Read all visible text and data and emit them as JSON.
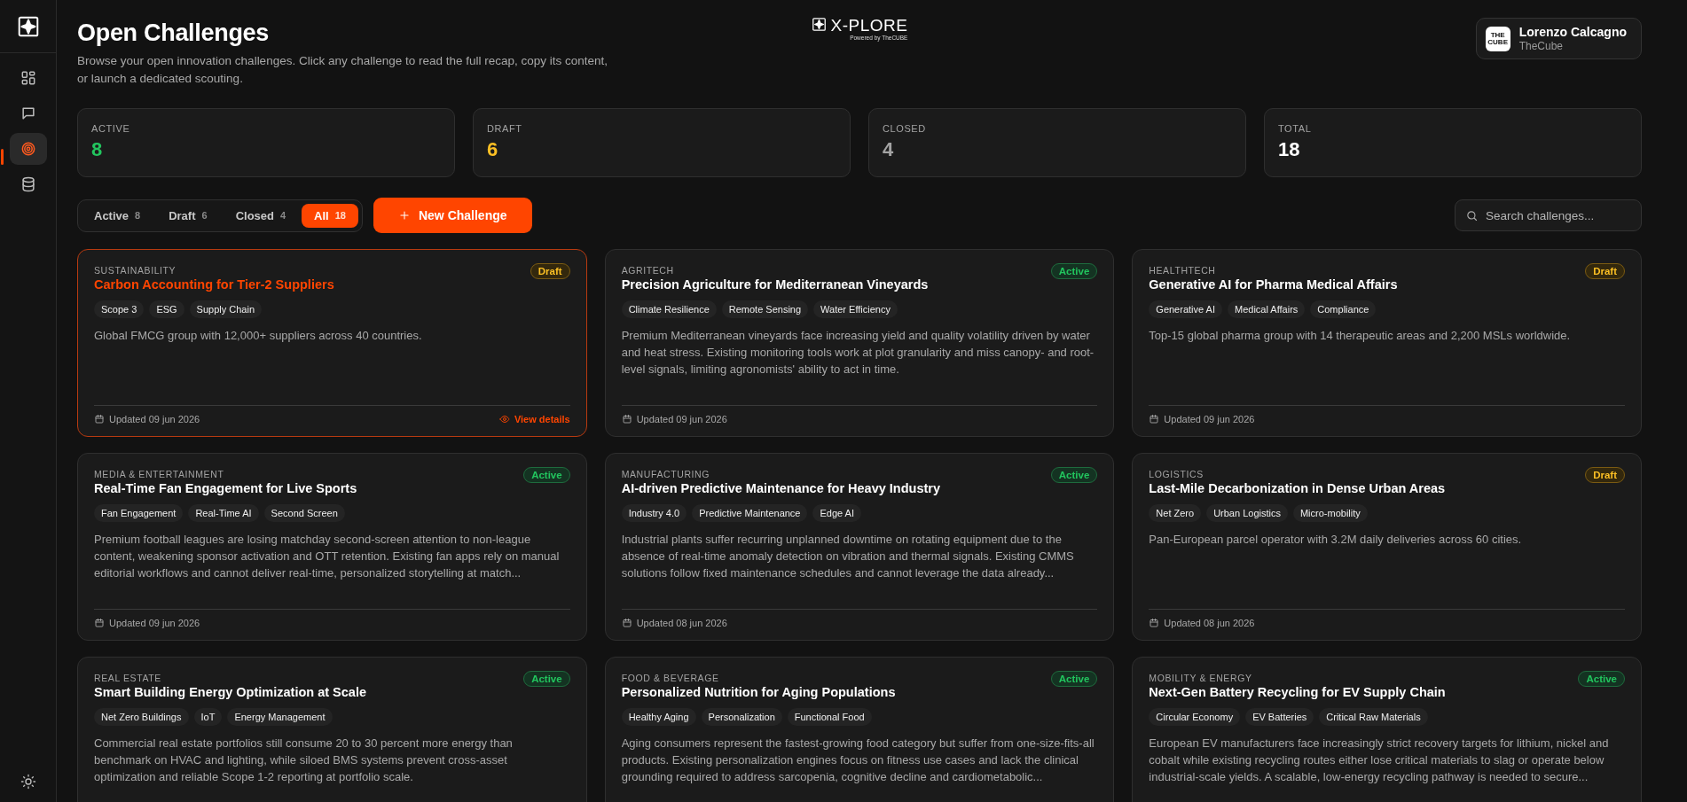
{
  "sidebar": {
    "items": [
      {
        "kind": "dashboard",
        "selected": false
      },
      {
        "kind": "chat",
        "selected": false
      },
      {
        "kind": "target",
        "selected": true
      },
      {
        "kind": "database",
        "selected": false
      }
    ]
  },
  "header": {
    "title": "Open Challenges",
    "subtitle": "Browse your open innovation challenges. Click any challenge to read the full recap, copy its content, or launch a dedicated scouting.",
    "brand": "X-PLORE",
    "brand_tagline": "Powered by TheCUBE",
    "user": {
      "avatar": "THE CUBE",
      "name": "Lorenzo Calcagno",
      "org": "TheCube"
    }
  },
  "stats": [
    {
      "label": "ACTIVE",
      "value": "8",
      "color": "#22c55e"
    },
    {
      "label": "DRAFT",
      "value": "6",
      "color": "#fbbf24"
    },
    {
      "label": "CLOSED",
      "value": "4",
      "color": "#a3a3a3"
    },
    {
      "label": "TOTAL",
      "value": "18",
      "color": "#ffffff"
    }
  ],
  "tabs": [
    {
      "label": "Active",
      "count": "8",
      "selected": false
    },
    {
      "label": "Draft",
      "count": "6",
      "selected": false
    },
    {
      "label": "Closed",
      "count": "4",
      "selected": false
    },
    {
      "label": "All",
      "count": "18",
      "selected": true
    }
  ],
  "new_button": "New Challenge",
  "search": {
    "placeholder": "Search challenges..."
  },
  "cards": [
    {
      "category": "SUSTAINABILITY",
      "title": "Carbon Accounting for Tier-2 Suppliers",
      "status": "Draft",
      "kind": "draft",
      "selected": true,
      "tags": [
        "Scope 3",
        "ESG",
        "Supply Chain"
      ],
      "description": "Global FMCG group with 12,000+ suppliers across 40 countries.",
      "updated": "Updated 09 jun 2026",
      "action": "View details"
    },
    {
      "category": "AGRITECH",
      "title": "Precision Agriculture for Mediterranean Vineyards",
      "status": "Active",
      "kind": "active",
      "selected": false,
      "tags": [
        "Climate Resilience",
        "Remote Sensing",
        "Water Efficiency"
      ],
      "description": "Premium Mediterranean vineyards face increasing yield and quality volatility driven by water and heat stress. Existing monitoring tools work at plot granularity and miss canopy- and root-level signals, limiting agronomists' ability to act in time.",
      "updated": "Updated 09 jun 2026"
    },
    {
      "category": "HEALTHTECH",
      "title": "Generative AI for Pharma Medical Affairs",
      "status": "Draft",
      "kind": "draft",
      "selected": false,
      "tags": [
        "Generative AI",
        "Medical Affairs",
        "Compliance"
      ],
      "description": "Top-15 global pharma group with 14 therapeutic areas and 2,200 MSLs worldwide.",
      "updated": "Updated 09 jun 2026"
    },
    {
      "category": "MEDIA & ENTERTAINMENT",
      "title": "Real-Time Fan Engagement for Live Sports",
      "status": "Active",
      "kind": "active",
      "selected": false,
      "tags": [
        "Fan Engagement",
        "Real-Time AI",
        "Second Screen"
      ],
      "description": "Premium football leagues are losing matchday second-screen attention to non-league content, weakening sponsor activation and OTT retention. Existing fan apps rely on manual editorial workflows and cannot deliver real-time, personalized storytelling at match...",
      "updated": "Updated 09 jun 2026"
    },
    {
      "category": "MANUFACTURING",
      "title": "AI-driven Predictive Maintenance for Heavy Industry",
      "status": "Active",
      "kind": "active",
      "selected": false,
      "tags": [
        "Industry 4.0",
        "Predictive Maintenance",
        "Edge AI"
      ],
      "description": "Industrial plants suffer recurring unplanned downtime on rotating equipment due to the absence of real-time anomaly detection on vibration and thermal signals. Existing CMMS solutions follow fixed maintenance schedules and cannot leverage the data already...",
      "updated": "Updated 08 jun 2026"
    },
    {
      "category": "LOGISTICS",
      "title": "Last-Mile Decarbonization in Dense Urban Areas",
      "status": "Draft",
      "kind": "draft",
      "selected": false,
      "tags": [
        "Net Zero",
        "Urban Logistics",
        "Micro-mobility"
      ],
      "description": "Pan-European parcel operator with 3.2M daily deliveries across 60 cities.",
      "updated": "Updated 08 jun 2026"
    },
    {
      "category": "REAL ESTATE",
      "title": "Smart Building Energy Optimization at Scale",
      "status": "Active",
      "kind": "active",
      "selected": false,
      "tags": [
        "Net Zero Buildings",
        "IoT",
        "Energy Management"
      ],
      "description": "Commercial real estate portfolios still consume 20 to 30 percent more energy than benchmark on HVAC and lighting, while siloed BMS systems prevent cross-asset optimization and reliable Scope 1-2 reporting at portfolio scale."
    },
    {
      "category": "FOOD & BEVERAGE",
      "title": "Personalized Nutrition for Aging Populations",
      "status": "Active",
      "kind": "active",
      "selected": false,
      "tags": [
        "Healthy Aging",
        "Personalization",
        "Functional Food"
      ],
      "description": "Aging consumers represent the fastest-growing food category but suffer from one-size-fits-all products. Existing personalization engines focus on fitness use cases and lack the clinical grounding required to address sarcopenia, cognitive decline and cardiometabolic..."
    },
    {
      "category": "MOBILITY & ENERGY",
      "title": "Next-Gen Battery Recycling for EV Supply Chain",
      "status": "Active",
      "kind": "active",
      "selected": false,
      "tags": [
        "Circular Economy",
        "EV Batteries",
        "Critical Raw Materials"
      ],
      "description": "European EV manufacturers face increasingly strict recovery targets for lithium, nickel and cobalt while existing recycling routes either lose critical materials to slag or operate below industrial-scale yields. A scalable, low-energy recycling pathway is needed to secure..."
    }
  ]
}
